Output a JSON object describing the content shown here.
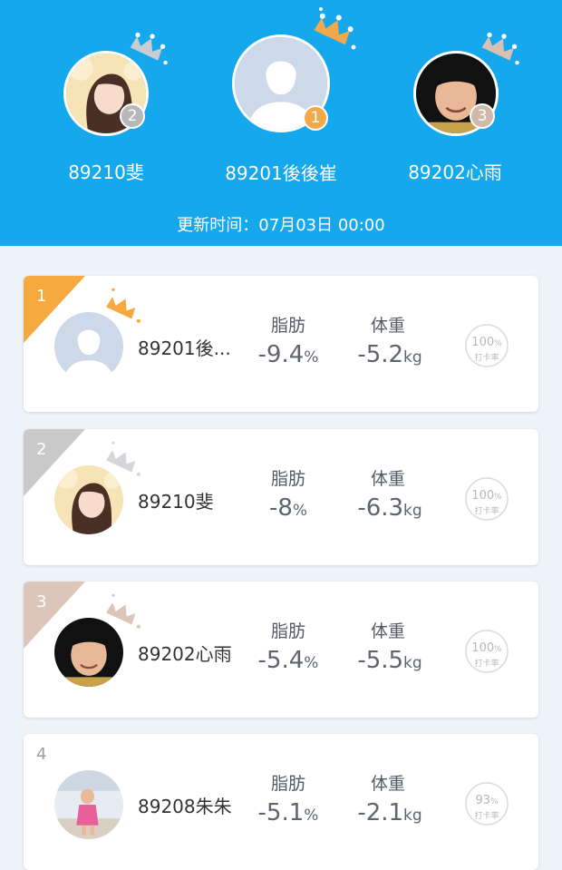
{
  "podium": [
    {
      "name": "89201後後崔",
      "rank": "1",
      "badge_color": "#f3a94a"
    },
    {
      "name": "89210斐",
      "rank": "2",
      "badge_color": "#b6b7b9"
    },
    {
      "name": "89202心雨",
      "rank": "3",
      "badge_color": "#d2b7ab"
    }
  ],
  "update_time": "更新时间：07月03日 00:00",
  "labels": {
    "fat": "脂肪",
    "weight": "体重",
    "kg": "kg",
    "checkin": "打卡率",
    "pct": "%"
  },
  "rows": [
    {
      "rank": "1",
      "name": "89201後...",
      "fat": "-9.4",
      "fat_unit": "%",
      "weight": "-5.2",
      "rate": "100",
      "corner_color": "#f5a93e"
    },
    {
      "rank": "2",
      "name": "89210斐",
      "fat": "-8",
      "fat_unit": "%",
      "weight": "-6.3",
      "rate": "100",
      "corner_color": "#c9c9c9"
    },
    {
      "rank": "3",
      "name": "89202心雨",
      "fat": "-5.4",
      "fat_unit": "%",
      "weight": "-5.5",
      "rate": "100",
      "corner_color": "#dcc5b9"
    },
    {
      "rank": "4",
      "name": "89208朱朱",
      "fat": "-5.1",
      "fat_unit": "%",
      "weight": "-2.1",
      "rate": "93",
      "corner_color": ""
    }
  ],
  "colors": {
    "header_bg": "#16a8ec",
    "gold": "#f5a93e",
    "silver": "#c9c9c9",
    "bronze": "#dcc5b9"
  }
}
